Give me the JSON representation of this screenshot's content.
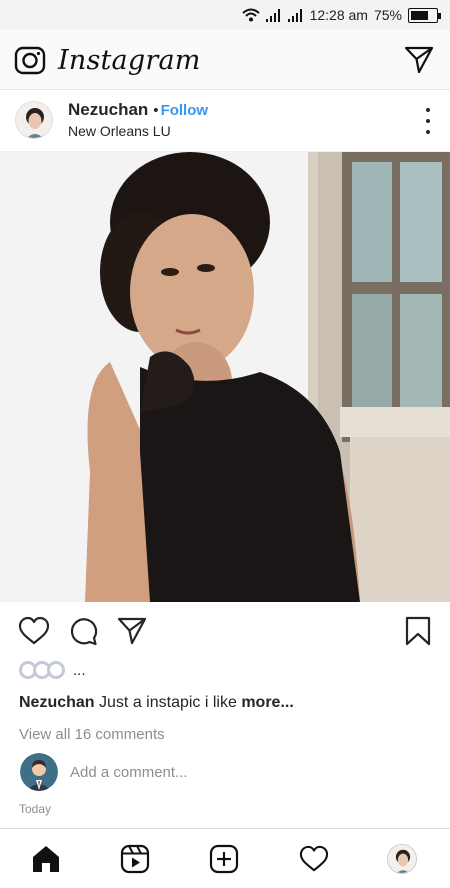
{
  "status_bar": {
    "time": "12:28 am",
    "battery": "75%",
    "battery_level": 0.75
  },
  "header": {
    "app_name": "Instagram"
  },
  "post": {
    "username": "Nezuchan",
    "separator": "•",
    "follow_label": "Follow",
    "location": "New Orleans LU",
    "likes_text": "...",
    "caption_user": "Nezuchan",
    "caption_text": "Just a instapic i like",
    "caption_more": "more...",
    "view_comments": "View all 16 comments",
    "comment_placeholder": "Add a comment...",
    "timestamp": "Today"
  },
  "icons": {
    "header": [
      "camera-icon",
      "direct-message-icon"
    ],
    "actions": [
      "heart-icon",
      "comment-icon",
      "share-icon",
      "bookmark-icon"
    ],
    "nav": [
      "home-icon",
      "reels-icon",
      "new-post-icon",
      "activity-icon",
      "profile-avatar"
    ]
  },
  "colors": {
    "link_blue": "#3897f0",
    "text": "#262626",
    "muted": "#8e8e8e"
  }
}
